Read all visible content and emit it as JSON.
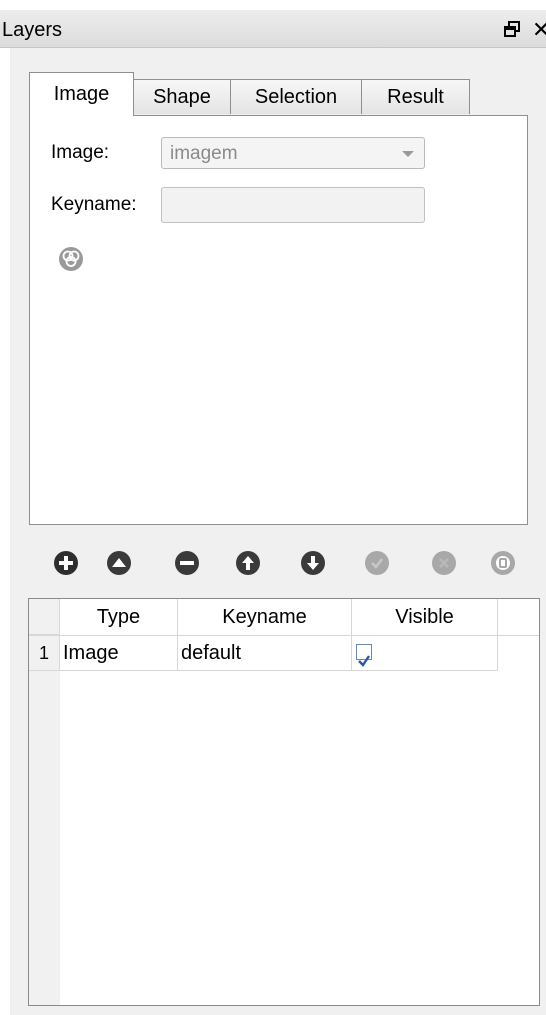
{
  "window": {
    "title": "Layers",
    "float_icon": "float-window-icon",
    "close_label": "✕"
  },
  "tabs": [
    {
      "label": "Image",
      "active": true
    },
    {
      "label": "Shape",
      "active": false
    },
    {
      "label": "Selection",
      "active": false
    },
    {
      "label": "Result",
      "active": false
    }
  ],
  "image_tab": {
    "image_label": "Image:",
    "image_value": "imagem",
    "keyname_label": "Keyname:",
    "keyname_value": "",
    "color_button_icon": "color-palette-icon"
  },
  "toolbar": {
    "icons": [
      {
        "name": "add-layer-icon",
        "enabled": true
      },
      {
        "name": "move-top-icon",
        "enabled": true
      },
      {
        "name": "remove-layer-icon",
        "enabled": true
      },
      {
        "name": "move-up-icon",
        "enabled": true
      },
      {
        "name": "move-down-icon",
        "enabled": true
      },
      {
        "name": "layer-option-icon",
        "enabled": false
      },
      {
        "name": "layer-delete-icon",
        "enabled": false
      },
      {
        "name": "layer-properties-icon",
        "enabled": false
      }
    ]
  },
  "table": {
    "columns": [
      "Type",
      "Keyname",
      "Visible"
    ],
    "rows": [
      {
        "num": "1",
        "type": "Image",
        "keyname": "default",
        "visible": true
      }
    ]
  },
  "colors": {
    "icon_enabled": "#3a3a3a",
    "icon_disabled": "#a8a8a8",
    "checkbox_check": "#2c54a8"
  }
}
